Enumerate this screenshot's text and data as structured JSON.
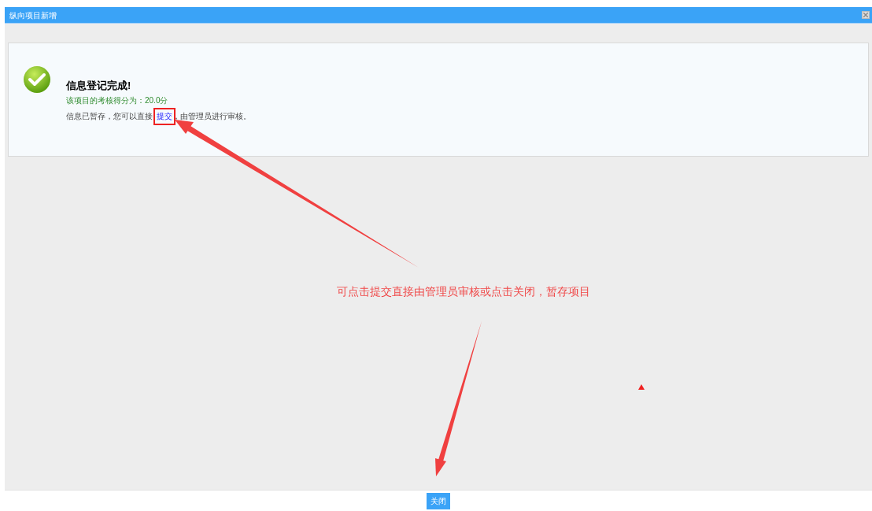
{
  "window": {
    "title": "纵向项目新增"
  },
  "message": {
    "title": "信息登记完成!",
    "score": "该项目的考核得分为：20.0分",
    "note_before": "信息已暂存，您可以直接",
    "link": "提交",
    "note_after": "，由管理员进行审核。"
  },
  "annotation": {
    "text": "可点击提交直接由管理员审核或点击关闭，暂存项目"
  },
  "buttons": [
    {
      "label": "关闭"
    }
  ]
}
